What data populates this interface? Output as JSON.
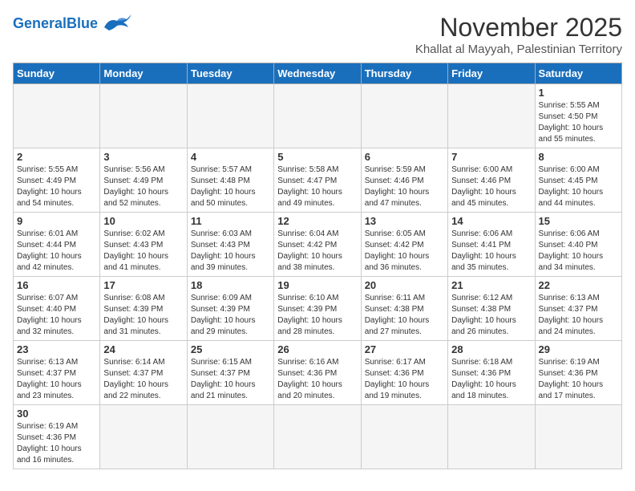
{
  "header": {
    "logo_general": "General",
    "logo_blue": "Blue",
    "month_title": "November 2025",
    "location": "Khallat al Mayyah, Palestinian Territory"
  },
  "days_of_week": [
    "Sunday",
    "Monday",
    "Tuesday",
    "Wednesday",
    "Thursday",
    "Friday",
    "Saturday"
  ],
  "weeks": [
    [
      {
        "day": "",
        "info": ""
      },
      {
        "day": "",
        "info": ""
      },
      {
        "day": "",
        "info": ""
      },
      {
        "day": "",
        "info": ""
      },
      {
        "day": "",
        "info": ""
      },
      {
        "day": "",
        "info": ""
      },
      {
        "day": "1",
        "info": "Sunrise: 5:55 AM\nSunset: 4:50 PM\nDaylight: 10 hours\nand 55 minutes."
      }
    ],
    [
      {
        "day": "2",
        "info": "Sunrise: 5:55 AM\nSunset: 4:49 PM\nDaylight: 10 hours\nand 54 minutes."
      },
      {
        "day": "3",
        "info": "Sunrise: 5:56 AM\nSunset: 4:49 PM\nDaylight: 10 hours\nand 52 minutes."
      },
      {
        "day": "4",
        "info": "Sunrise: 5:57 AM\nSunset: 4:48 PM\nDaylight: 10 hours\nand 50 minutes."
      },
      {
        "day": "5",
        "info": "Sunrise: 5:58 AM\nSunset: 4:47 PM\nDaylight: 10 hours\nand 49 minutes."
      },
      {
        "day": "6",
        "info": "Sunrise: 5:59 AM\nSunset: 4:46 PM\nDaylight: 10 hours\nand 47 minutes."
      },
      {
        "day": "7",
        "info": "Sunrise: 6:00 AM\nSunset: 4:46 PM\nDaylight: 10 hours\nand 45 minutes."
      },
      {
        "day": "8",
        "info": "Sunrise: 6:00 AM\nSunset: 4:45 PM\nDaylight: 10 hours\nand 44 minutes."
      }
    ],
    [
      {
        "day": "9",
        "info": "Sunrise: 6:01 AM\nSunset: 4:44 PM\nDaylight: 10 hours\nand 42 minutes."
      },
      {
        "day": "10",
        "info": "Sunrise: 6:02 AM\nSunset: 4:43 PM\nDaylight: 10 hours\nand 41 minutes."
      },
      {
        "day": "11",
        "info": "Sunrise: 6:03 AM\nSunset: 4:43 PM\nDaylight: 10 hours\nand 39 minutes."
      },
      {
        "day": "12",
        "info": "Sunrise: 6:04 AM\nSunset: 4:42 PM\nDaylight: 10 hours\nand 38 minutes."
      },
      {
        "day": "13",
        "info": "Sunrise: 6:05 AM\nSunset: 4:42 PM\nDaylight: 10 hours\nand 36 minutes."
      },
      {
        "day": "14",
        "info": "Sunrise: 6:06 AM\nSunset: 4:41 PM\nDaylight: 10 hours\nand 35 minutes."
      },
      {
        "day": "15",
        "info": "Sunrise: 6:06 AM\nSunset: 4:40 PM\nDaylight: 10 hours\nand 34 minutes."
      }
    ],
    [
      {
        "day": "16",
        "info": "Sunrise: 6:07 AM\nSunset: 4:40 PM\nDaylight: 10 hours\nand 32 minutes."
      },
      {
        "day": "17",
        "info": "Sunrise: 6:08 AM\nSunset: 4:39 PM\nDaylight: 10 hours\nand 31 minutes."
      },
      {
        "day": "18",
        "info": "Sunrise: 6:09 AM\nSunset: 4:39 PM\nDaylight: 10 hours\nand 29 minutes."
      },
      {
        "day": "19",
        "info": "Sunrise: 6:10 AM\nSunset: 4:39 PM\nDaylight: 10 hours\nand 28 minutes."
      },
      {
        "day": "20",
        "info": "Sunrise: 6:11 AM\nSunset: 4:38 PM\nDaylight: 10 hours\nand 27 minutes."
      },
      {
        "day": "21",
        "info": "Sunrise: 6:12 AM\nSunset: 4:38 PM\nDaylight: 10 hours\nand 26 minutes."
      },
      {
        "day": "22",
        "info": "Sunrise: 6:13 AM\nSunset: 4:37 PM\nDaylight: 10 hours\nand 24 minutes."
      }
    ],
    [
      {
        "day": "23",
        "info": "Sunrise: 6:13 AM\nSunset: 4:37 PM\nDaylight: 10 hours\nand 23 minutes."
      },
      {
        "day": "24",
        "info": "Sunrise: 6:14 AM\nSunset: 4:37 PM\nDaylight: 10 hours\nand 22 minutes."
      },
      {
        "day": "25",
        "info": "Sunrise: 6:15 AM\nSunset: 4:37 PM\nDaylight: 10 hours\nand 21 minutes."
      },
      {
        "day": "26",
        "info": "Sunrise: 6:16 AM\nSunset: 4:36 PM\nDaylight: 10 hours\nand 20 minutes."
      },
      {
        "day": "27",
        "info": "Sunrise: 6:17 AM\nSunset: 4:36 PM\nDaylight: 10 hours\nand 19 minutes."
      },
      {
        "day": "28",
        "info": "Sunrise: 6:18 AM\nSunset: 4:36 PM\nDaylight: 10 hours\nand 18 minutes."
      },
      {
        "day": "29",
        "info": "Sunrise: 6:19 AM\nSunset: 4:36 PM\nDaylight: 10 hours\nand 17 minutes."
      }
    ],
    [
      {
        "day": "30",
        "info": "Sunrise: 6:19 AM\nSunset: 4:36 PM\nDaylight: 10 hours\nand 16 minutes."
      },
      {
        "day": "",
        "info": ""
      },
      {
        "day": "",
        "info": ""
      },
      {
        "day": "",
        "info": ""
      },
      {
        "day": "",
        "info": ""
      },
      {
        "day": "",
        "info": ""
      },
      {
        "day": "",
        "info": ""
      }
    ]
  ]
}
